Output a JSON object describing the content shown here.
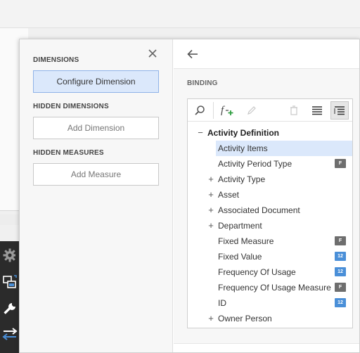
{
  "left_pane": {
    "dimensions_title": "DIMENSIONS",
    "configure_dimension": "Configure Dimension",
    "hidden_dimensions_title": "HIDDEN DIMENSIONS",
    "add_dimension": "Add Dimension",
    "hidden_measures_title": "HIDDEN MEASURES",
    "add_measure": "Add Measure"
  },
  "right_pane": {
    "binding_title": "BINDING"
  },
  "tree": {
    "root": {
      "label": "Activity Definition",
      "expander": "−"
    },
    "items": [
      {
        "label": "Activity Items",
        "expander": "",
        "badge": "",
        "selected": true
      },
      {
        "label": "Activity Period Type",
        "expander": "",
        "badge": "F"
      },
      {
        "label": "Activity Type",
        "expander": "+",
        "badge": ""
      },
      {
        "label": "Asset",
        "expander": "+",
        "badge": ""
      },
      {
        "label": "Associated Document",
        "expander": "+",
        "badge": ""
      },
      {
        "label": "Department",
        "expander": "+",
        "badge": ""
      },
      {
        "label": "Fixed Measure",
        "expander": "",
        "badge": "F"
      },
      {
        "label": "Fixed Value",
        "expander": "",
        "badge": "12"
      },
      {
        "label": "Frequency Of Usage",
        "expander": "",
        "badge": "12"
      },
      {
        "label": "Frequency Of Usage Measure",
        "expander": "",
        "badge": "F"
      },
      {
        "label": "ID",
        "expander": "",
        "badge": "12"
      },
      {
        "label": "Owner Person",
        "expander": "+",
        "badge": ""
      }
    ]
  },
  "colors": {
    "badge_text_type": "#6e6e6e",
    "badge_number_type": "#4a8fd8",
    "accent_blue": "#3a7fd6",
    "selection": "#dbe8fb",
    "toolbar_dark": "#2b2b2b"
  },
  "icons": {
    "toolbar": [
      "gear-icon",
      "dashboard-item-icon",
      "wrench-icon",
      "convert-arrows-icon"
    ],
    "tree_toolbar": [
      "search-icon",
      "add-calculated-field-icon",
      "edit-icon",
      "delete-icon",
      "list-view-icon",
      "tree-view-icon"
    ]
  }
}
